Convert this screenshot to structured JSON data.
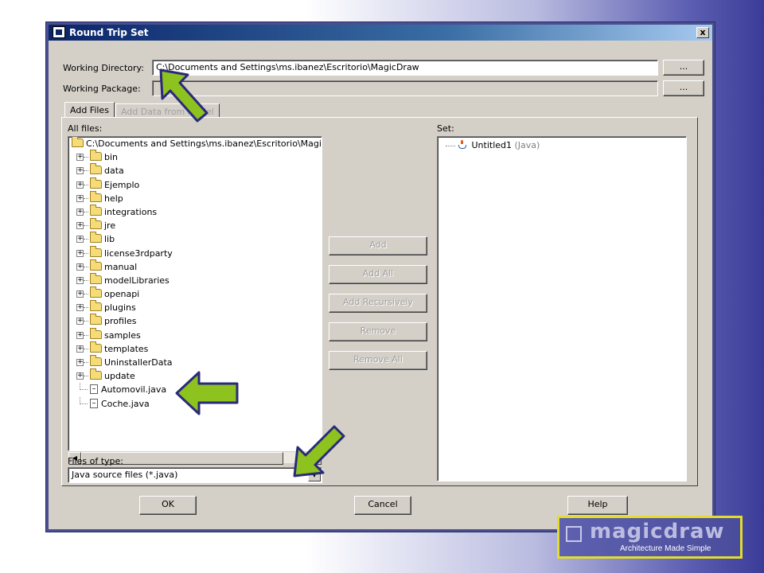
{
  "window": {
    "title": "Round Trip Set",
    "close_label": "x"
  },
  "working_directory": {
    "label": "Working Directory:",
    "value": "C:\\Documents and Settings\\ms.ibanez\\Escritorio\\MagicDraw",
    "browse_label": "..."
  },
  "working_package": {
    "label": "Working Package:",
    "value": "",
    "browse_label": "..."
  },
  "tabs": [
    {
      "label": "Add Files",
      "active": true
    },
    {
      "label": "Add Data from Model",
      "active": false
    }
  ],
  "all_files": {
    "label": "All files:",
    "root": "C:\\Documents and Settings\\ms.ibanez\\Escritorio\\Magic",
    "folders": [
      "bin",
      "data",
      "Ejemplo",
      "help",
      "integrations",
      "jre",
      "lib",
      "license3rdparty",
      "manual",
      "modelLibraries",
      "openapi",
      "plugins",
      "profiles",
      "samples",
      "templates",
      "UninstallerData",
      "update"
    ],
    "files": [
      "Automovil.java",
      "Coche.java"
    ]
  },
  "files_of_type": {
    "label": "Files of type:",
    "value": "Java source files (*.java)"
  },
  "actions": {
    "add": "Add",
    "add_all": "Add All",
    "add_recursively": "Add Recursively",
    "remove": "Remove",
    "remove_all": "Remove All"
  },
  "set": {
    "label": "Set:",
    "item_name": "Untitled1",
    "item_type": "(Java)"
  },
  "footer": {
    "ok": "OK",
    "cancel": "Cancel",
    "help": "Help"
  },
  "logo": {
    "name": "magicdraw",
    "tagline": "Architecture Made Simple"
  },
  "colors": {
    "arrow_fill": "#8dc21f",
    "arrow_stroke": "#2a2a7a",
    "titlebar": "#0a246a",
    "logo_border": "#e2dc2c"
  }
}
